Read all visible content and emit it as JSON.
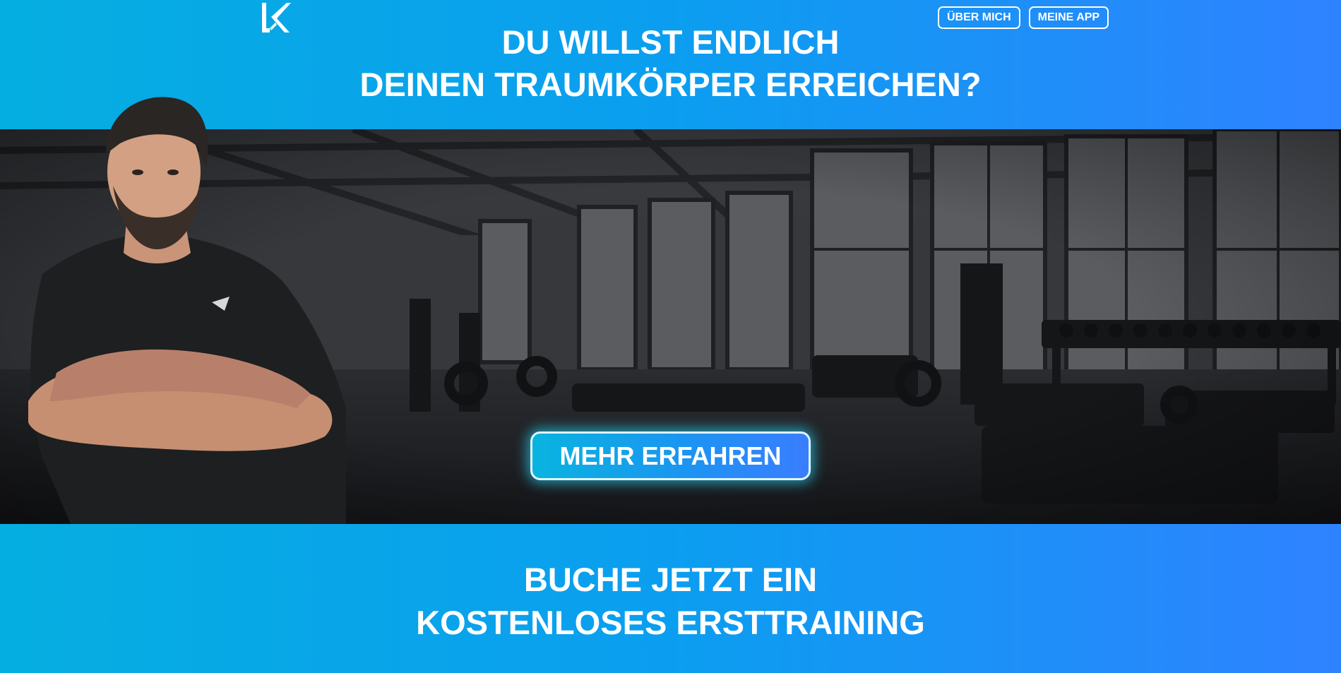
{
  "brand": {
    "logo_text": "LK"
  },
  "nav": {
    "about_label": "ÜBER MICH",
    "app_label": "MEINE APP"
  },
  "hero": {
    "headline_line1": "DU WILLST ENDLICH",
    "headline_line2": "DEINEN TRAUMKÖRPER ERREICHEN?",
    "cta_label": "MEHR ERFAHREN"
  },
  "footer": {
    "headline_line1": "BUCHE JETZT EIN",
    "headline_line2": "KOSTENLOSES ERSTTRAINING"
  },
  "colors": {
    "gradient_start": "#05aee0",
    "gradient_end": "#2f82ff",
    "text": "#ffffff",
    "hero_dark": "#2c2e32"
  },
  "icons": {
    "logo": "lk-monogram-icon"
  }
}
